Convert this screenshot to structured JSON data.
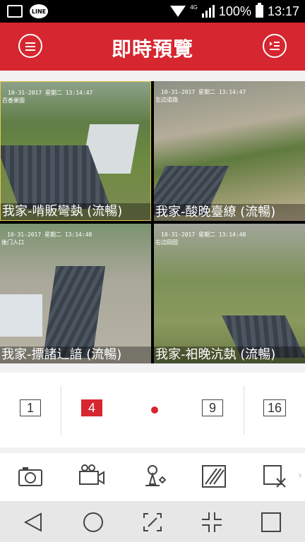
{
  "status_bar": {
    "network": "4G",
    "battery": "100%",
    "time": "13:17",
    "icons": [
      "gallery-icon",
      "line-app-icon",
      "wifi-icon",
      "signal-icon",
      "battery-icon"
    ]
  },
  "header": {
    "title": "即時預覽",
    "menu_icon": "menu-icon",
    "list_icon": "playlist-icon"
  },
  "cameras": [
    {
      "timestamp": "10-31-2017 星期二 13:14:47",
      "location": "百香果園",
      "caption": "我家-啃販彎埶 (流暢)"
    },
    {
      "timestamp": "10-31-2017 星期二 13:14:47",
      "location": "左边道路",
      "caption": "我家-酸晚臺繚 (流暢)"
    },
    {
      "timestamp": "10-31-2017 星期二 13:14:48",
      "location": "後门入口",
      "caption": "我家-摽諸辶諳 (流暢)"
    },
    {
      "timestamp": "10-31-2017 星期二 13:14:48",
      "location": "右边田园",
      "caption": "我家-衵晚沆埶 (流暢)"
    }
  ],
  "layout_options": [
    "1",
    "4",
    "9",
    "16"
  ],
  "selected_layout": "4",
  "toolbar": [
    "camera-icon",
    "video-record-icon",
    "ptz-icon",
    "image-quality-icon",
    "close-all-icon"
  ],
  "nav": [
    "back-icon",
    "home-icon",
    "screenshot-icon",
    "collapse-icon",
    "recent-apps-icon"
  ],
  "colors": {
    "brand": "#d6262f",
    "statusbar": "#000000"
  }
}
